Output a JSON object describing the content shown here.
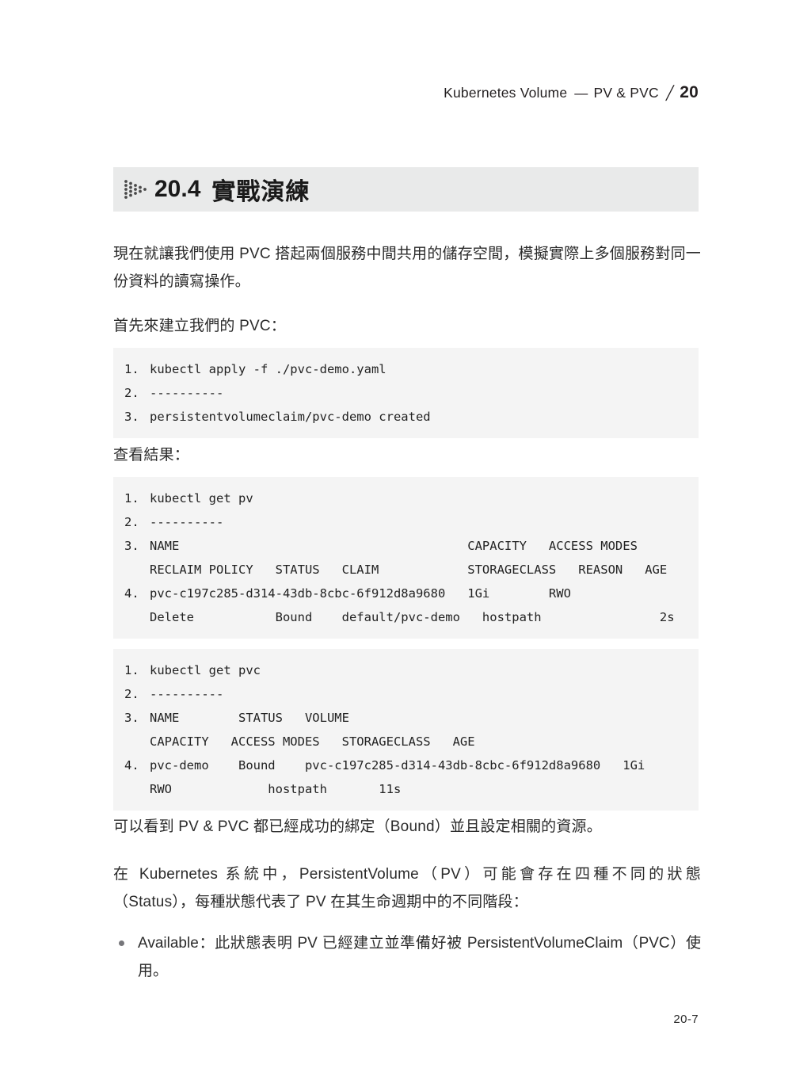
{
  "header": {
    "title": "Kubernetes Volume",
    "separator_dash": "—",
    "subtitle": "PV & PVC",
    "slash": "╱",
    "chapter_number": "20"
  },
  "section": {
    "number": "20.4",
    "title": "實戰演練",
    "icon": "dotted-arrow-icon",
    "band_color": "#e9eaea"
  },
  "paragraphs": {
    "intro": "現在就讓我們使用 PVC 搭起兩個服務中間共用的儲存空間，模擬實際上多個服務對同一份資料的讀寫操作。",
    "create_pvc": "首先來建立我們的 PVC：",
    "check_result": "查看結果：",
    "bound_note": "可以看到 PV & PVC 都已經成功的綁定（Bound）並且設定相關的資源。",
    "status_intro": "在 Kubernetes 系統中，PersistentVolume（PV）可能會存在四種不同的狀態（Status），每種狀態代表了 PV 在其生命週期中的不同階段："
  },
  "code_blocks": [
    {
      "id": "apply-pvc",
      "lines": [
        {
          "num": "1.",
          "text": "kubectl apply -f ./pvc-demo.yaml"
        },
        {
          "num": "2.",
          "text": "----------"
        },
        {
          "num": "3.",
          "text": "persistentvolumeclaim/pvc-demo created"
        }
      ]
    },
    {
      "id": "get-pv",
      "lines": [
        {
          "num": "1.",
          "text": "kubectl get pv"
        },
        {
          "num": "2.",
          "text": "----------"
        },
        {
          "num": "3.",
          "text": "NAME                                       CAPACITY   ACCESS MODES",
          "text2": "RECLAIM POLICY   STATUS   CLAIM            STORAGECLASS   REASON   AGE"
        },
        {
          "num": "4.",
          "text": "pvc-c197c285-d314-43db-8cbc-6f912d8a9680   1Gi        RWO",
          "text2": "Delete           Bound    default/pvc-demo   hostpath                2s"
        }
      ]
    },
    {
      "id": "get-pvc",
      "lines": [
        {
          "num": "1.",
          "text": "kubectl get pvc"
        },
        {
          "num": "2.",
          "text": "----------"
        },
        {
          "num": "3.",
          "text": "NAME        STATUS   VOLUME",
          "text2": "CAPACITY   ACCESS MODES   STORAGECLASS   AGE"
        },
        {
          "num": "4.",
          "text": "pvc-demo    Bound    pvc-c197c285-d314-43db-8cbc-6f912d8a9680   1Gi",
          "text2": "RWO             hostpath       11s"
        }
      ]
    }
  ],
  "bullets": [
    {
      "text": "Available：此狀態表明 PV 已經建立並準備好被 PersistentVolumeClaim（PVC）使用。"
    }
  ],
  "footer": {
    "page_label": "20-7"
  }
}
